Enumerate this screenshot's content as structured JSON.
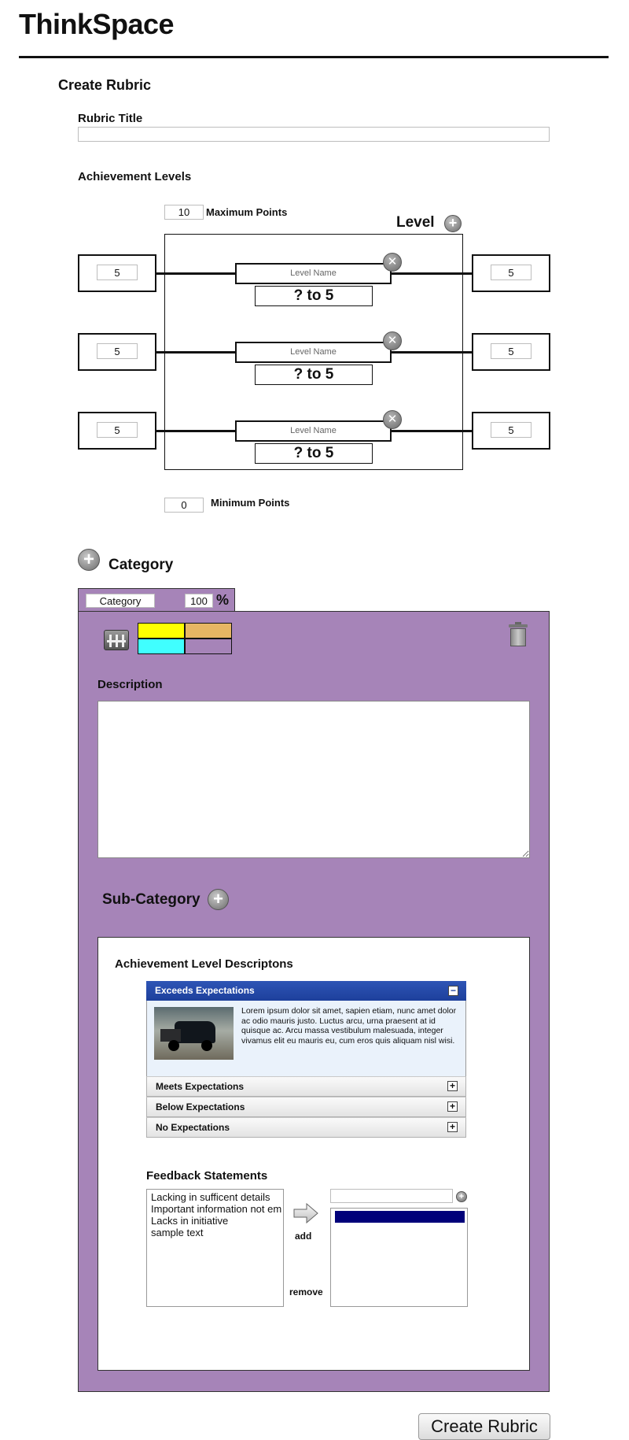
{
  "app": {
    "title": "ThinkSpace"
  },
  "page": {
    "heading": "Create Rubric"
  },
  "rubric_title": {
    "label": "Rubric Title",
    "value": ""
  },
  "achievement": {
    "heading": "Achievement Levels",
    "max_points": "10",
    "max_label": "Maximum Points",
    "level_label": "Level",
    "min_points": "0",
    "min_label": "Minimum Points",
    "levels": [
      {
        "left_value": "5",
        "right_value": "5",
        "name_placeholder": "Level Name",
        "range": "? to 5"
      },
      {
        "left_value": "5",
        "right_value": "5",
        "name_placeholder": "Level Name",
        "range": "? to 5"
      },
      {
        "left_value": "5",
        "right_value": "5",
        "name_placeholder": "Level Name",
        "range": "? to 5"
      }
    ]
  },
  "category": {
    "heading": "Category",
    "tab_name": "Category",
    "percent": "100",
    "percent_symbol": "%",
    "colors": [
      "#ffff00",
      "#e6b663",
      "#40ffff",
      "#a684b8"
    ],
    "description_label": "Description",
    "description_value": "",
    "subcategory_label": "Sub-Category",
    "panel_color": "#a684b8"
  },
  "descriptions": {
    "heading": "Achievement Level Descriptons",
    "active": {
      "title": "Exceeds Expectations",
      "body": "Lorem ipsum dolor sit amet, sapien etiam, nunc amet dolor ac odio mauris justo. Luctus arcu, urna praesent at id quisque ac. Arcu massa vestibulum malesuada, integer vivamus elit eu mauris eu, cum eros quis aliquam nisl wisi."
    },
    "collapsed": [
      "Meets Expectations",
      "Below Expectations",
      "No Expectations"
    ]
  },
  "feedback": {
    "heading": "Feedback Statements",
    "items": [
      "Lacking in sufficent details",
      "Important information not em",
      "Lacks in initiative",
      "sample text"
    ],
    "add_label": "add",
    "remove_label": "remove",
    "new_value": ""
  },
  "actions": {
    "create_label": "Create Rubric"
  }
}
